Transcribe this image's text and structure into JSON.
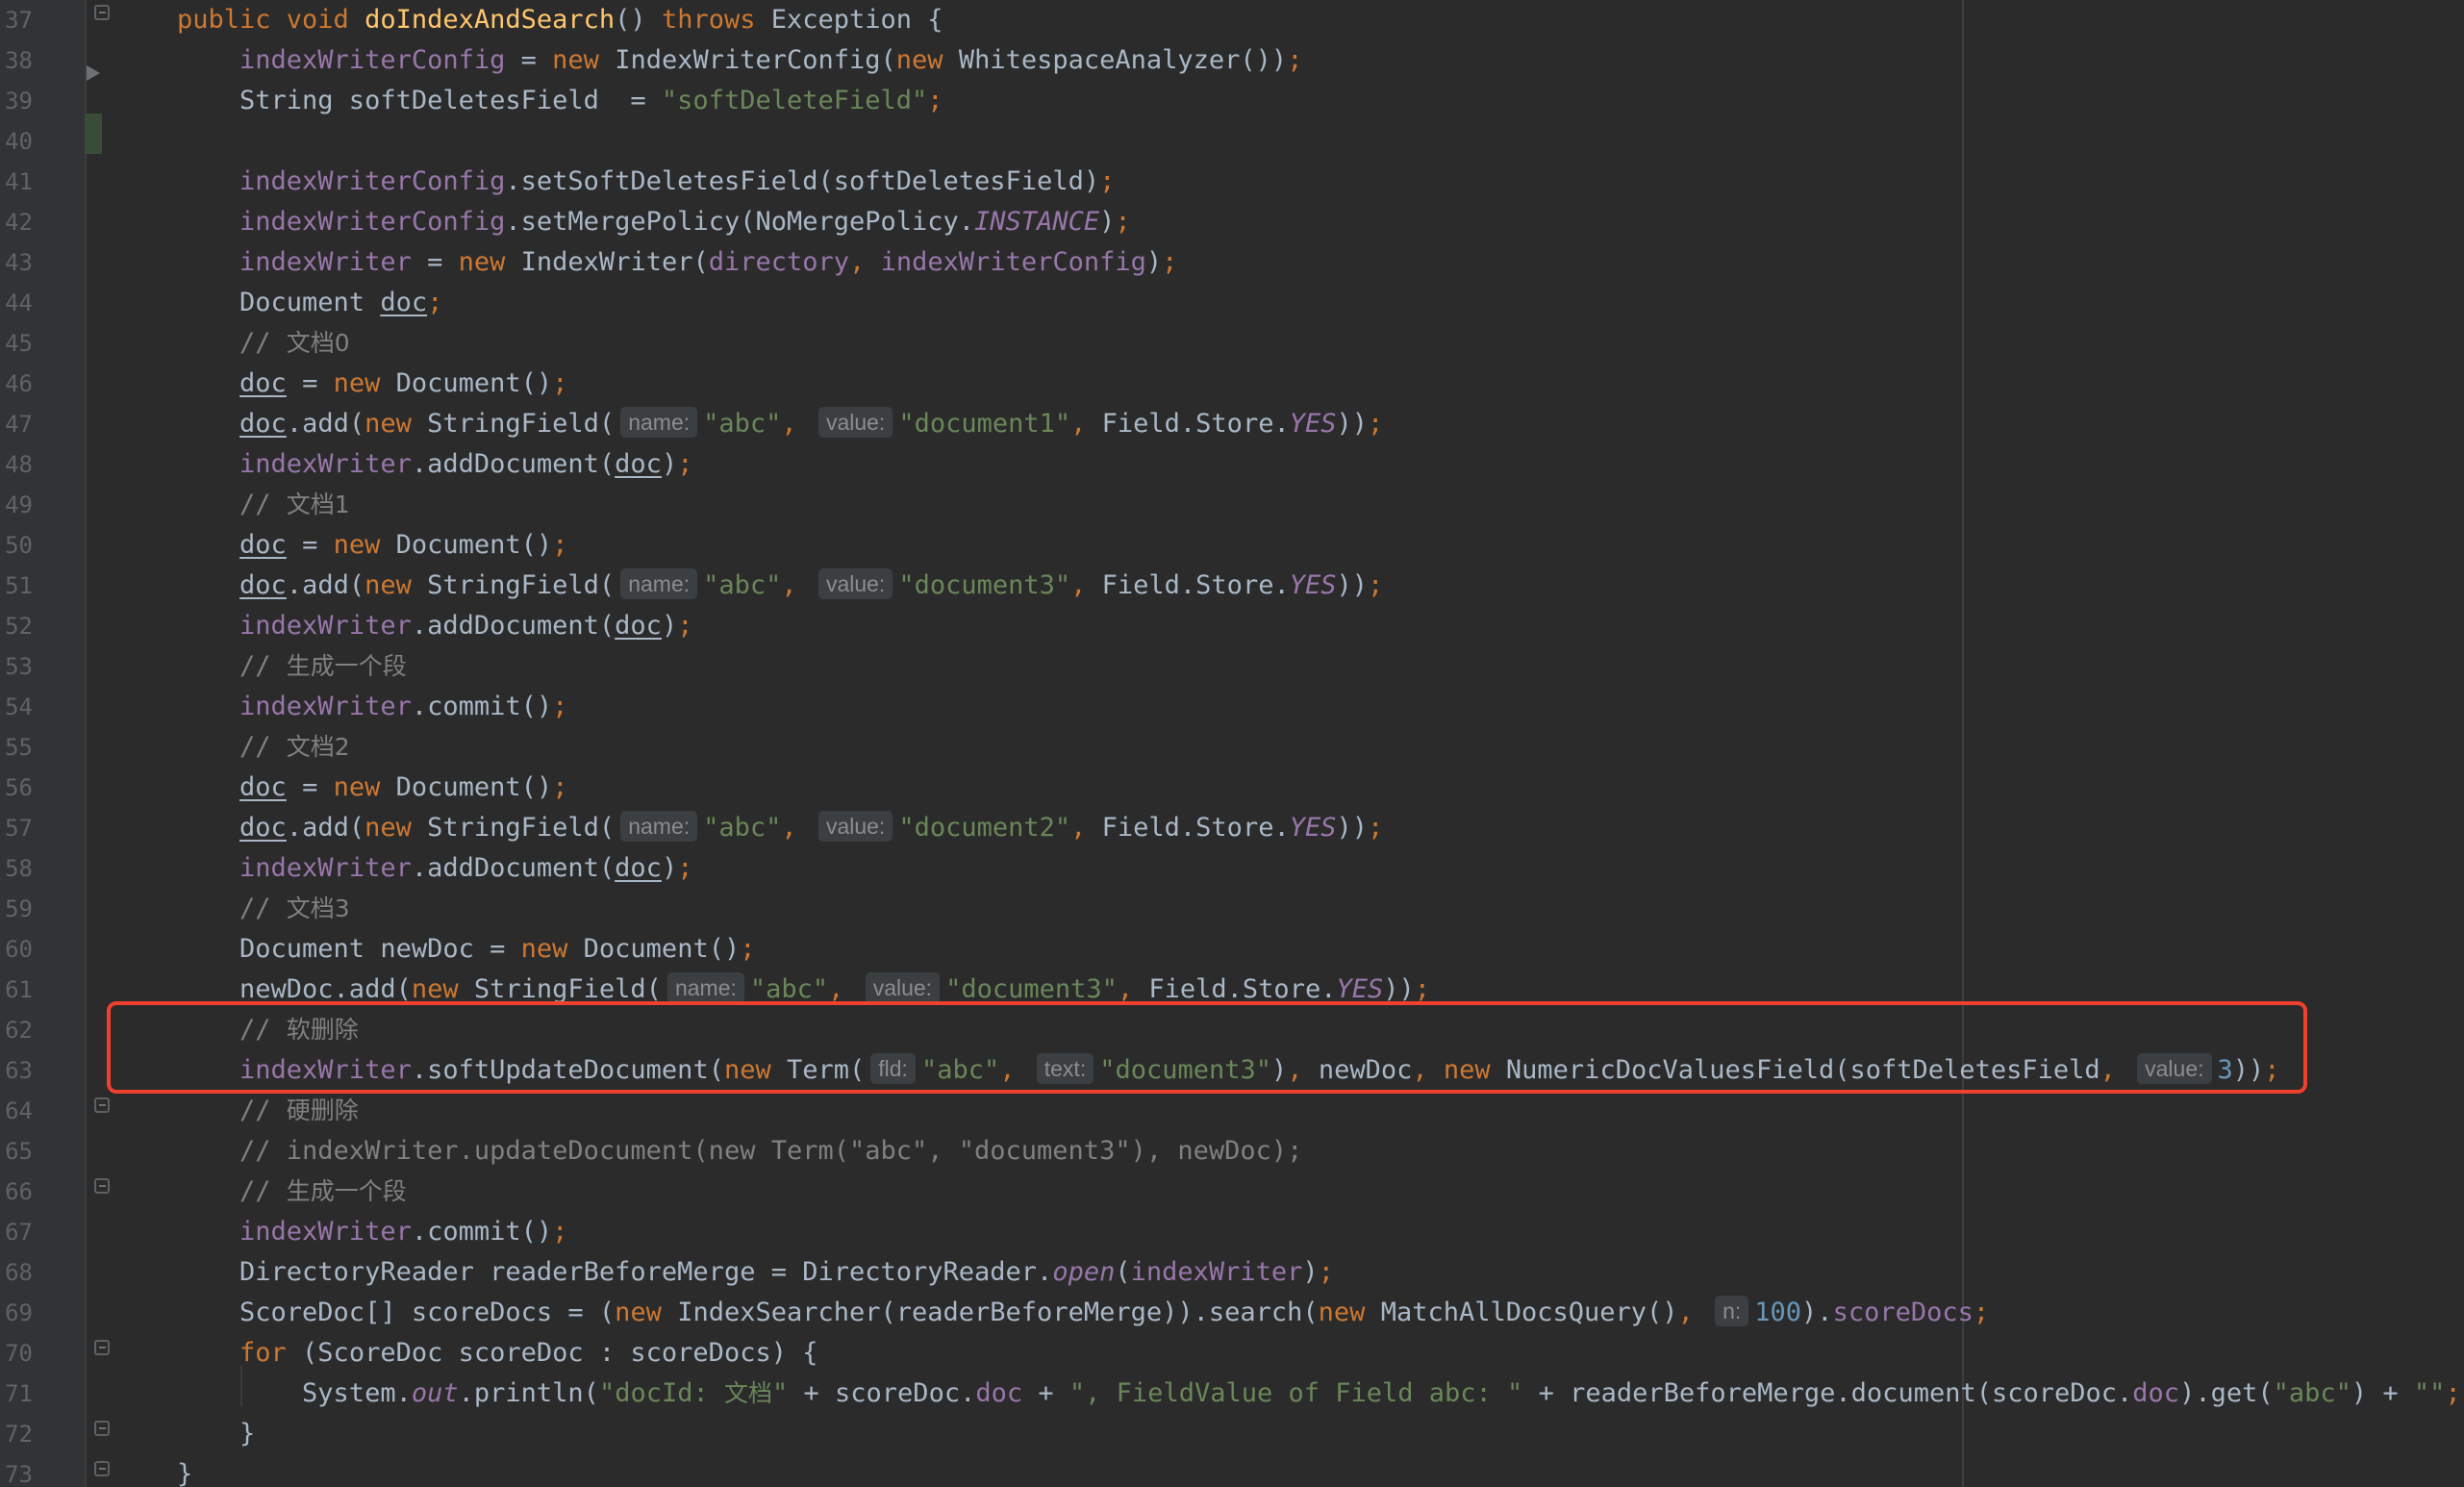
{
  "editor": {
    "first_line_number": 37,
    "lines": [
      [
        [
          "keyword",
          "public void "
        ],
        [
          "method",
          "doIndexAndSearch"
        ],
        [
          "default",
          "() "
        ],
        [
          "keyword",
          "throws "
        ],
        [
          "default",
          "Exception {"
        ]
      ],
      [
        [
          "default",
          "    "
        ],
        [
          "field",
          "indexWriterConfig"
        ],
        [
          "default",
          " = "
        ],
        [
          "keyword",
          "new "
        ],
        [
          "default",
          "IndexWriterConfig("
        ],
        [
          "keyword",
          "new "
        ],
        [
          "default",
          "WhitespaceAnalyzer())"
        ],
        [
          "keyword",
          ";"
        ]
      ],
      [
        [
          "default",
          "    String softDeletesField  = "
        ],
        [
          "string",
          "\"softDeleteField\""
        ],
        [
          "keyword",
          ";"
        ]
      ],
      [],
      [
        [
          "default",
          "    "
        ],
        [
          "field",
          "indexWriterConfig"
        ],
        [
          "default",
          ".setSoftDeletesField(softDeletesField)"
        ],
        [
          "keyword",
          ";"
        ]
      ],
      [
        [
          "default",
          "    "
        ],
        [
          "field",
          "indexWriterConfig"
        ],
        [
          "default",
          ".setMergePolicy(NoMergePolicy."
        ],
        [
          "static",
          "INSTANCE"
        ],
        [
          "default",
          ")"
        ],
        [
          "keyword",
          ";"
        ]
      ],
      [
        [
          "default",
          "    "
        ],
        [
          "field",
          "indexWriter"
        ],
        [
          "default",
          " = "
        ],
        [
          "keyword",
          "new "
        ],
        [
          "default",
          "IndexWriter("
        ],
        [
          "field",
          "directory"
        ],
        [
          "keyword",
          ", "
        ],
        [
          "field",
          "indexWriterConfig"
        ],
        [
          "default",
          ")"
        ],
        [
          "keyword",
          ";"
        ]
      ],
      [
        [
          "default",
          "    Document "
        ],
        [
          "local",
          "doc"
        ],
        [
          "keyword",
          ";"
        ]
      ],
      [
        [
          "comment",
          "    // "
        ],
        [
          "cjk-comment",
          "文档0"
        ]
      ],
      [
        [
          "default",
          "    "
        ],
        [
          "local",
          "doc"
        ],
        [
          "default",
          " = "
        ],
        [
          "keyword",
          "new "
        ],
        [
          "default",
          "Document()"
        ],
        [
          "keyword",
          ";"
        ]
      ],
      [
        [
          "default",
          "    "
        ],
        [
          "local",
          "doc"
        ],
        [
          "default",
          ".add("
        ],
        [
          "keyword",
          "new "
        ],
        [
          "default",
          "StringField("
        ],
        [
          "hint",
          "name:"
        ],
        [
          "string",
          "\"abc\""
        ],
        [
          "keyword",
          ", "
        ],
        [
          "hint",
          "value:"
        ],
        [
          "string",
          "\"document1\""
        ],
        [
          "keyword",
          ", "
        ],
        [
          "default",
          "Field.Store."
        ],
        [
          "static",
          "YES"
        ],
        [
          "default",
          "))"
        ],
        [
          "keyword",
          ";"
        ]
      ],
      [
        [
          "default",
          "    "
        ],
        [
          "field",
          "indexWriter"
        ],
        [
          "default",
          ".addDocument("
        ],
        [
          "local",
          "doc"
        ],
        [
          "default",
          ")"
        ],
        [
          "keyword",
          ";"
        ]
      ],
      [
        [
          "comment",
          "    // "
        ],
        [
          "cjk-comment",
          "文档1"
        ]
      ],
      [
        [
          "default",
          "    "
        ],
        [
          "local",
          "doc"
        ],
        [
          "default",
          " = "
        ],
        [
          "keyword",
          "new "
        ],
        [
          "default",
          "Document()"
        ],
        [
          "keyword",
          ";"
        ]
      ],
      [
        [
          "default",
          "    "
        ],
        [
          "local",
          "doc"
        ],
        [
          "default",
          ".add("
        ],
        [
          "keyword",
          "new "
        ],
        [
          "default",
          "StringField("
        ],
        [
          "hint",
          "name:"
        ],
        [
          "string",
          "\"abc\""
        ],
        [
          "keyword",
          ", "
        ],
        [
          "hint",
          "value:"
        ],
        [
          "string",
          "\"document3\""
        ],
        [
          "keyword",
          ", "
        ],
        [
          "default",
          "Field.Store."
        ],
        [
          "static",
          "YES"
        ],
        [
          "default",
          "))"
        ],
        [
          "keyword",
          ";"
        ]
      ],
      [
        [
          "default",
          "    "
        ],
        [
          "field",
          "indexWriter"
        ],
        [
          "default",
          ".addDocument("
        ],
        [
          "local",
          "doc"
        ],
        [
          "default",
          ")"
        ],
        [
          "keyword",
          ";"
        ]
      ],
      [
        [
          "comment",
          "    // "
        ],
        [
          "cjk-comment",
          "生成一个段"
        ]
      ],
      [
        [
          "default",
          "    "
        ],
        [
          "field",
          "indexWriter"
        ],
        [
          "default",
          ".commit()"
        ],
        [
          "keyword",
          ";"
        ]
      ],
      [
        [
          "comment",
          "    // "
        ],
        [
          "cjk-comment",
          "文档2"
        ]
      ],
      [
        [
          "default",
          "    "
        ],
        [
          "local",
          "doc"
        ],
        [
          "default",
          " = "
        ],
        [
          "keyword",
          "new "
        ],
        [
          "default",
          "Document()"
        ],
        [
          "keyword",
          ";"
        ]
      ],
      [
        [
          "default",
          "    "
        ],
        [
          "local",
          "doc"
        ],
        [
          "default",
          ".add("
        ],
        [
          "keyword",
          "new "
        ],
        [
          "default",
          "StringField("
        ],
        [
          "hint",
          "name:"
        ],
        [
          "string",
          "\"abc\""
        ],
        [
          "keyword",
          ", "
        ],
        [
          "hint",
          "value:"
        ],
        [
          "string",
          "\"document2\""
        ],
        [
          "keyword",
          ", "
        ],
        [
          "default",
          "Field.Store."
        ],
        [
          "static",
          "YES"
        ],
        [
          "default",
          "))"
        ],
        [
          "keyword",
          ";"
        ]
      ],
      [
        [
          "default",
          "    "
        ],
        [
          "field",
          "indexWriter"
        ],
        [
          "default",
          ".addDocument("
        ],
        [
          "local",
          "doc"
        ],
        [
          "default",
          ")"
        ],
        [
          "keyword",
          ";"
        ]
      ],
      [
        [
          "comment",
          "    // "
        ],
        [
          "cjk-comment",
          "文档3"
        ]
      ],
      [
        [
          "default",
          "    Document newDoc = "
        ],
        [
          "keyword",
          "new "
        ],
        [
          "default",
          "Document()"
        ],
        [
          "keyword",
          ";"
        ]
      ],
      [
        [
          "default",
          "    newDoc.add("
        ],
        [
          "keyword",
          "new "
        ],
        [
          "default",
          "StringField("
        ],
        [
          "hint",
          "name:"
        ],
        [
          "string",
          "\"abc\""
        ],
        [
          "keyword",
          ", "
        ],
        [
          "hint",
          "value:"
        ],
        [
          "string",
          "\"document3\""
        ],
        [
          "keyword",
          ", "
        ],
        [
          "default",
          "Field.Store."
        ],
        [
          "static",
          "YES"
        ],
        [
          "default",
          "))"
        ],
        [
          "keyword",
          ";"
        ]
      ],
      [
        [
          "comment",
          "    // "
        ],
        [
          "cjk-comment",
          "软删除"
        ]
      ],
      [
        [
          "default",
          "    "
        ],
        [
          "field",
          "indexWriter"
        ],
        [
          "default",
          ".softUpdateDocument("
        ],
        [
          "keyword",
          "new "
        ],
        [
          "default",
          "Term("
        ],
        [
          "hint",
          "fld:"
        ],
        [
          "string",
          "\"abc\""
        ],
        [
          "keyword",
          ", "
        ],
        [
          "hint",
          "text:"
        ],
        [
          "string",
          "\"document3\""
        ],
        [
          "default",
          ")"
        ],
        [
          "keyword",
          ", "
        ],
        [
          "default",
          "newDoc"
        ],
        [
          "keyword",
          ", new "
        ],
        [
          "default",
          "NumericDocValuesField(softDeletesField"
        ],
        [
          "keyword",
          ", "
        ],
        [
          "hint",
          "value:"
        ],
        [
          "number",
          "3"
        ],
        [
          "default",
          "))"
        ],
        [
          "keyword",
          ";"
        ]
      ],
      [
        [
          "comment",
          "    // "
        ],
        [
          "cjk-comment",
          "硬删除"
        ]
      ],
      [
        [
          "comment",
          "    // indexWriter.updateDocument(new Term(\"abc\", \"document3\"), newDoc);"
        ]
      ],
      [
        [
          "comment",
          "    // "
        ],
        [
          "cjk-comment",
          "生成一个段"
        ]
      ],
      [
        [
          "default",
          "    "
        ],
        [
          "field",
          "indexWriter"
        ],
        [
          "default",
          ".commit()"
        ],
        [
          "keyword",
          ";"
        ]
      ],
      [
        [
          "default",
          "    DirectoryReader readerBeforeMerge = DirectoryReader."
        ],
        [
          "static",
          "open"
        ],
        [
          "default",
          "("
        ],
        [
          "field",
          "indexWriter"
        ],
        [
          "default",
          ")"
        ],
        [
          "keyword",
          ";"
        ]
      ],
      [
        [
          "default",
          "    ScoreDoc[] scoreDocs = ("
        ],
        [
          "keyword",
          "new "
        ],
        [
          "default",
          "IndexSearcher(readerBeforeMerge)).search("
        ],
        [
          "keyword",
          "new "
        ],
        [
          "default",
          "MatchAllDocsQuery()"
        ],
        [
          "keyword",
          ", "
        ],
        [
          "hint",
          "n:"
        ],
        [
          "number",
          "100"
        ],
        [
          "default",
          ")."
        ],
        [
          "field",
          "scoreDocs"
        ],
        [
          "keyword",
          ";"
        ]
      ],
      [
        [
          "keyword",
          "    for "
        ],
        [
          "default",
          "(ScoreDoc scoreDoc : scoreDocs) {"
        ]
      ],
      [
        [
          "default",
          "        System."
        ],
        [
          "static",
          "out"
        ],
        [
          "default",
          ".println("
        ],
        [
          "string",
          "\"docId: "
        ],
        [
          "cjk-string",
          "文档"
        ],
        [
          "string",
          "\""
        ],
        [
          "default",
          " + scoreDoc."
        ],
        [
          "field",
          "doc"
        ],
        [
          "default",
          " + "
        ],
        [
          "string",
          "\", FieldValue of Field abc: \""
        ],
        [
          "default",
          " + readerBeforeMerge.document(scoreDoc."
        ],
        [
          "field",
          "doc"
        ],
        [
          "default",
          ").get("
        ],
        [
          "string",
          "\"abc\""
        ],
        [
          "default",
          ") + "
        ],
        [
          "string",
          "\"\""
        ],
        [
          "keyword",
          ";"
        ]
      ],
      [
        [
          "default",
          "    }"
        ]
      ],
      [
        [
          "default",
          "}"
        ]
      ]
    ]
  },
  "colors": {
    "background": "#2b2b2b",
    "gutter": "#313335",
    "keyword": "#cc7832",
    "method": "#ffc66d",
    "field": "#9876aa",
    "string": "#6a8759",
    "number": "#6897bb",
    "comment": "#808080",
    "highlight_box": "#f0402e"
  },
  "icons": {
    "fold_markers": "fold-icon",
    "run_gutter": "run-arrow-icon"
  }
}
